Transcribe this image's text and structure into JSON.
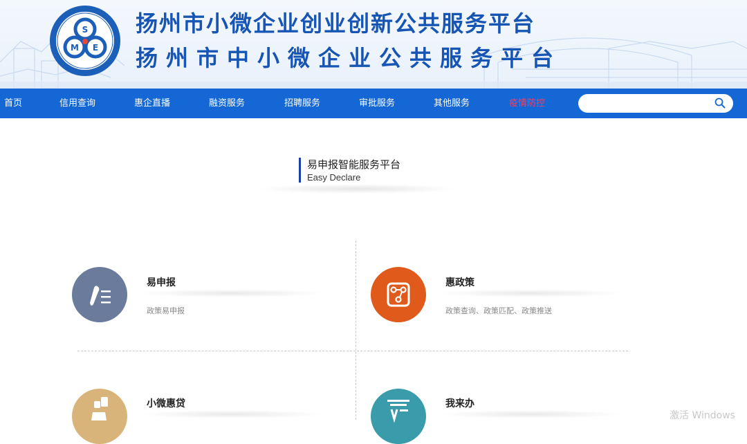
{
  "header": {
    "title_line1": "扬州市小微企业创业创新公共服务平台",
    "title_line2": "扬州市中小微企业公共服务平台",
    "logo_letters": [
      "S",
      "M",
      "E"
    ],
    "colors": {
      "title": "#1655b3",
      "nav_bg": "#1467d4",
      "highlight": "#ff3b5c"
    }
  },
  "nav": {
    "items": [
      {
        "label": "首页"
      },
      {
        "label": "信用查询"
      },
      {
        "label": "惠企直播"
      },
      {
        "label": "融资服务"
      },
      {
        "label": "招聘服务"
      },
      {
        "label": "审批服务"
      },
      {
        "label": "其他服务"
      },
      {
        "label": "疫情防控"
      }
    ],
    "search": {
      "placeholder": "",
      "icon": "search-icon"
    }
  },
  "section": {
    "title": "易申报智能服务平台",
    "subtitle": "Easy Declare"
  },
  "services": [
    {
      "title": "易申报",
      "desc": "政策易申报",
      "icon": "pen-list-icon",
      "color": "#6b7b9b"
    },
    {
      "title": "惠政策",
      "desc": "政策查询、政策匹配、政策推送",
      "icon": "policy-document-icon",
      "color": "#e05a1b"
    },
    {
      "title": "小微惠贷",
      "desc": "",
      "icon": "money-hand-icon",
      "color": "#d9b47a"
    },
    {
      "title": "我来办",
      "desc": "",
      "icon": "handle-tasks-icon",
      "color": "#3a9bab"
    }
  ],
  "watermark": "激活 Windows"
}
